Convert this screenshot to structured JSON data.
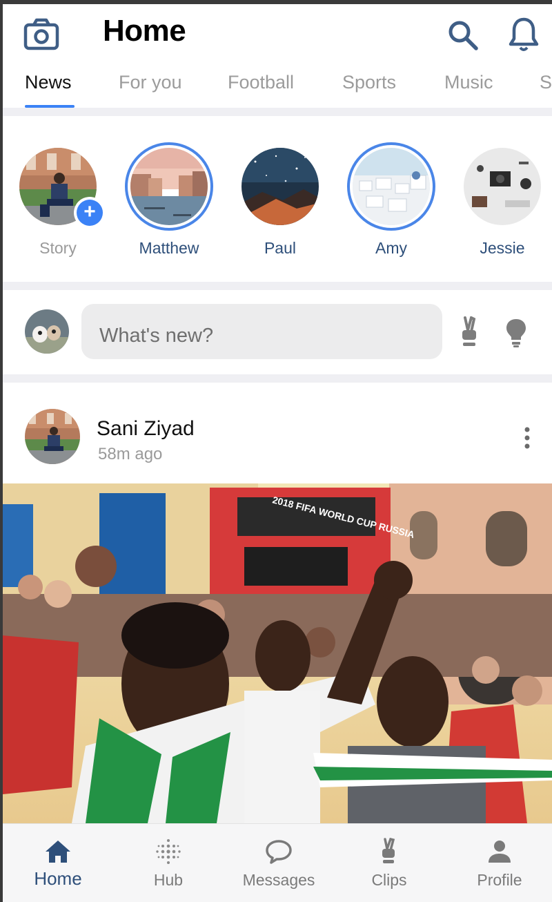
{
  "header": {
    "title": "Home",
    "icons": [
      "camera-icon",
      "search-icon",
      "bell-icon"
    ]
  },
  "tabs": [
    {
      "label": "News",
      "active": true
    },
    {
      "label": "For you"
    },
    {
      "label": "Football"
    },
    {
      "label": "Sports"
    },
    {
      "label": "Music"
    },
    {
      "label": "S"
    }
  ],
  "stories": [
    {
      "name": "Story",
      "own": true
    },
    {
      "name": "Matthew",
      "active": true
    },
    {
      "name": "Paul"
    },
    {
      "name": "Amy",
      "active": true
    },
    {
      "name": "Jessie"
    }
  ],
  "composer": {
    "placeholder": "What's new?",
    "icons": [
      "peace-sign-icon",
      "lightbulb-icon"
    ]
  },
  "post": {
    "author": "Sani Ziyad",
    "time": "58m ago",
    "image_banner_text": "2018 FIFA WORLD CUP RUSSIA"
  },
  "bottom_nav": [
    {
      "label": "Home",
      "icon": "home-icon",
      "active": true
    },
    {
      "label": "Hub",
      "icon": "hub-dots-icon"
    },
    {
      "label": "Messages",
      "icon": "chat-bubble-icon"
    },
    {
      "label": "Clips",
      "icon": "peace-sign-icon"
    },
    {
      "label": "Profile",
      "icon": "person-icon"
    }
  ],
  "colors": {
    "accent": "#3b82f6",
    "nav_active": "#2e4f7a",
    "icon_dark": "#3f5e86",
    "muted": "#9a9a9a"
  }
}
